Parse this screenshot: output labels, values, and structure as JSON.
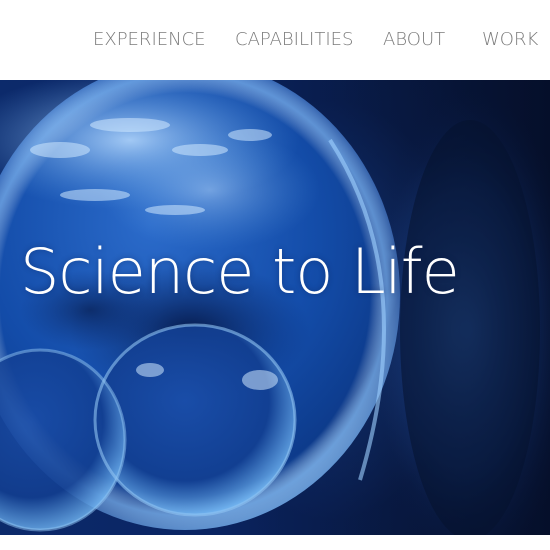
{
  "nav": {
    "items": [
      {
        "label": "EXPERIENCE"
      },
      {
        "label": "CAPABILITIES"
      },
      {
        "label": "ABOUT"
      },
      {
        "label": "WORK"
      }
    ]
  },
  "hero": {
    "title": "Science to Life"
  },
  "colors": {
    "nav_text": "#7a7a7a",
    "hero_text": "#ffffff",
    "hero_blue": "#0c2a6b",
    "cell_highlight": "#8fc3f2"
  }
}
